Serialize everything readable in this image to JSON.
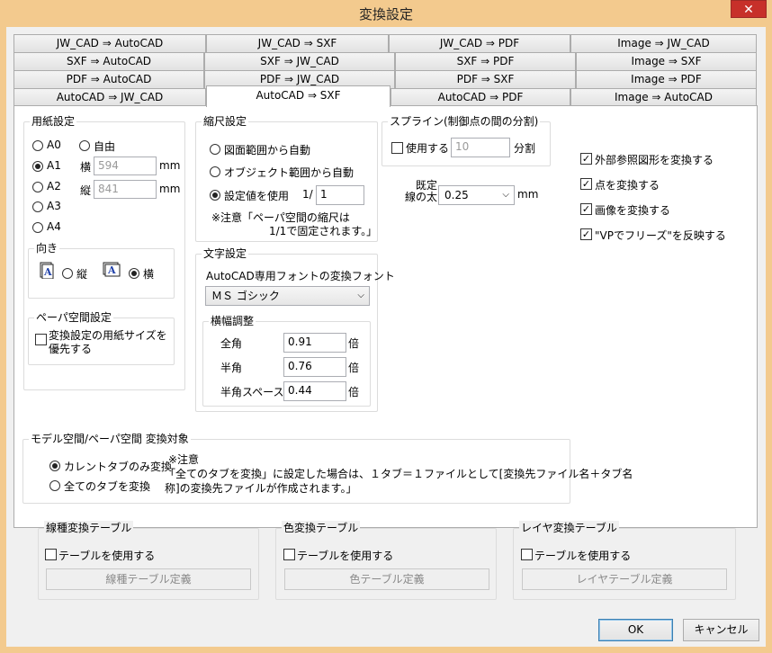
{
  "window": {
    "title": "変換設定",
    "close_glyph": "✕"
  },
  "tabs": {
    "row1": [
      "JW_CAD ⇒ AutoCAD",
      "JW_CAD ⇒ SXF",
      "JW_CAD ⇒ PDF",
      "Image ⇒ JW_CAD"
    ],
    "row2": [
      "SXF ⇒ AutoCAD",
      "SXF ⇒ JW_CAD",
      "SXF ⇒ PDF",
      "Image ⇒ SXF"
    ],
    "row3": [
      "PDF ⇒ AutoCAD",
      "PDF ⇒ JW_CAD",
      "PDF ⇒ SXF",
      "Image ⇒ PDF"
    ],
    "row4": [
      "AutoCAD ⇒ JW_CAD",
      "AutoCAD ⇒ SXF",
      "AutoCAD ⇒ PDF",
      "Image ⇒ AutoCAD"
    ],
    "active": "AutoCAD ⇒ SXF"
  },
  "paper": {
    "title": "用紙設定",
    "sizes": [
      "A0",
      "A1",
      "A2",
      "A3",
      "A4"
    ],
    "selected": "A1",
    "free_label": "自由",
    "width_label": "横",
    "width_value": "594",
    "height_label": "縦",
    "height_value": "841",
    "unit": "mm",
    "orientation_title": "向き",
    "portrait_label": "縦",
    "landscape_label": "横",
    "orientation_selected": "横"
  },
  "paper_space": {
    "title": "ペーパ空間設定",
    "checkbox_label": "変換設定の用紙サイズを優先する",
    "checked": false
  },
  "scale": {
    "title": "縮尺設定",
    "option1": "図面範囲から自動",
    "option2": "オブジェクト範囲から自動",
    "option3": "設定値を使用",
    "prefix": "1/",
    "value": "1",
    "note_line1": "※注意「ペーパ空間の縮尺は",
    "note_line2": "1/1で固定されます。」"
  },
  "spline": {
    "title": "スプライン(制御点の間の分割)",
    "checkbox_label": "使用する",
    "value": "10",
    "unit": "分割"
  },
  "line_width": {
    "label_line1": "既定",
    "label_line2": "線の太さ",
    "value": "0.25",
    "unit": "mm"
  },
  "options": [
    {
      "label": "外部参照図形を変換する",
      "checked": true
    },
    {
      "label": "点を変換する",
      "checked": true
    },
    {
      "label": "画像を変換する",
      "checked": true
    },
    {
      "label": "\"VPでフリーズ\"を反映する",
      "checked": true
    }
  ],
  "text": {
    "title": "文字設定",
    "font_label": "AutoCAD専用フォントの変換フォント",
    "font_value": "ＭＳ ゴシック",
    "width_title": "横幅調整",
    "rows": [
      {
        "label": "全角",
        "value": "0.91",
        "unit": "倍"
      },
      {
        "label": "半角",
        "value": "0.76",
        "unit": "倍"
      },
      {
        "label": "半角スペース",
        "value": "0.44",
        "unit": "倍"
      }
    ]
  },
  "space": {
    "title": "モデル空間/ペーパ空間  変換対象",
    "option1": "カレントタブのみ変換",
    "option2": "全てのタブを変換",
    "selected": 1,
    "note_title": "※注意",
    "note_line1": "「全てのタブを変換」に設定した場合は、１タブ＝１ファイルとして[変換先ファイル名＋タブ名",
    "note_line2": "称]の変換先ファイルが作成されます。」"
  },
  "tables": [
    {
      "title": "線種変換テーブル",
      "checkbox_label": "テーブルを使用する",
      "button_label": "線種テーブル定義"
    },
    {
      "title": "色変換テーブル",
      "checkbox_label": "テーブルを使用する",
      "button_label": "色テーブル定義"
    },
    {
      "title": "レイヤ変換テーブル",
      "checkbox_label": "テーブルを使用する",
      "button_label": "レイヤテーブル定義"
    }
  ],
  "footer": {
    "ok_label": "OK",
    "cancel_label": "キャンセル"
  },
  "icons": {
    "portrait": "document-portrait-icon",
    "landscape": "document-landscape-icon",
    "dropdown": "chevron-down-icon",
    "check": "checkmark-icon"
  },
  "colors": {
    "titlebar": "#f3ca8e",
    "close": "#c7302a",
    "panel": "#ffffff",
    "client": "#f0f0f0"
  }
}
